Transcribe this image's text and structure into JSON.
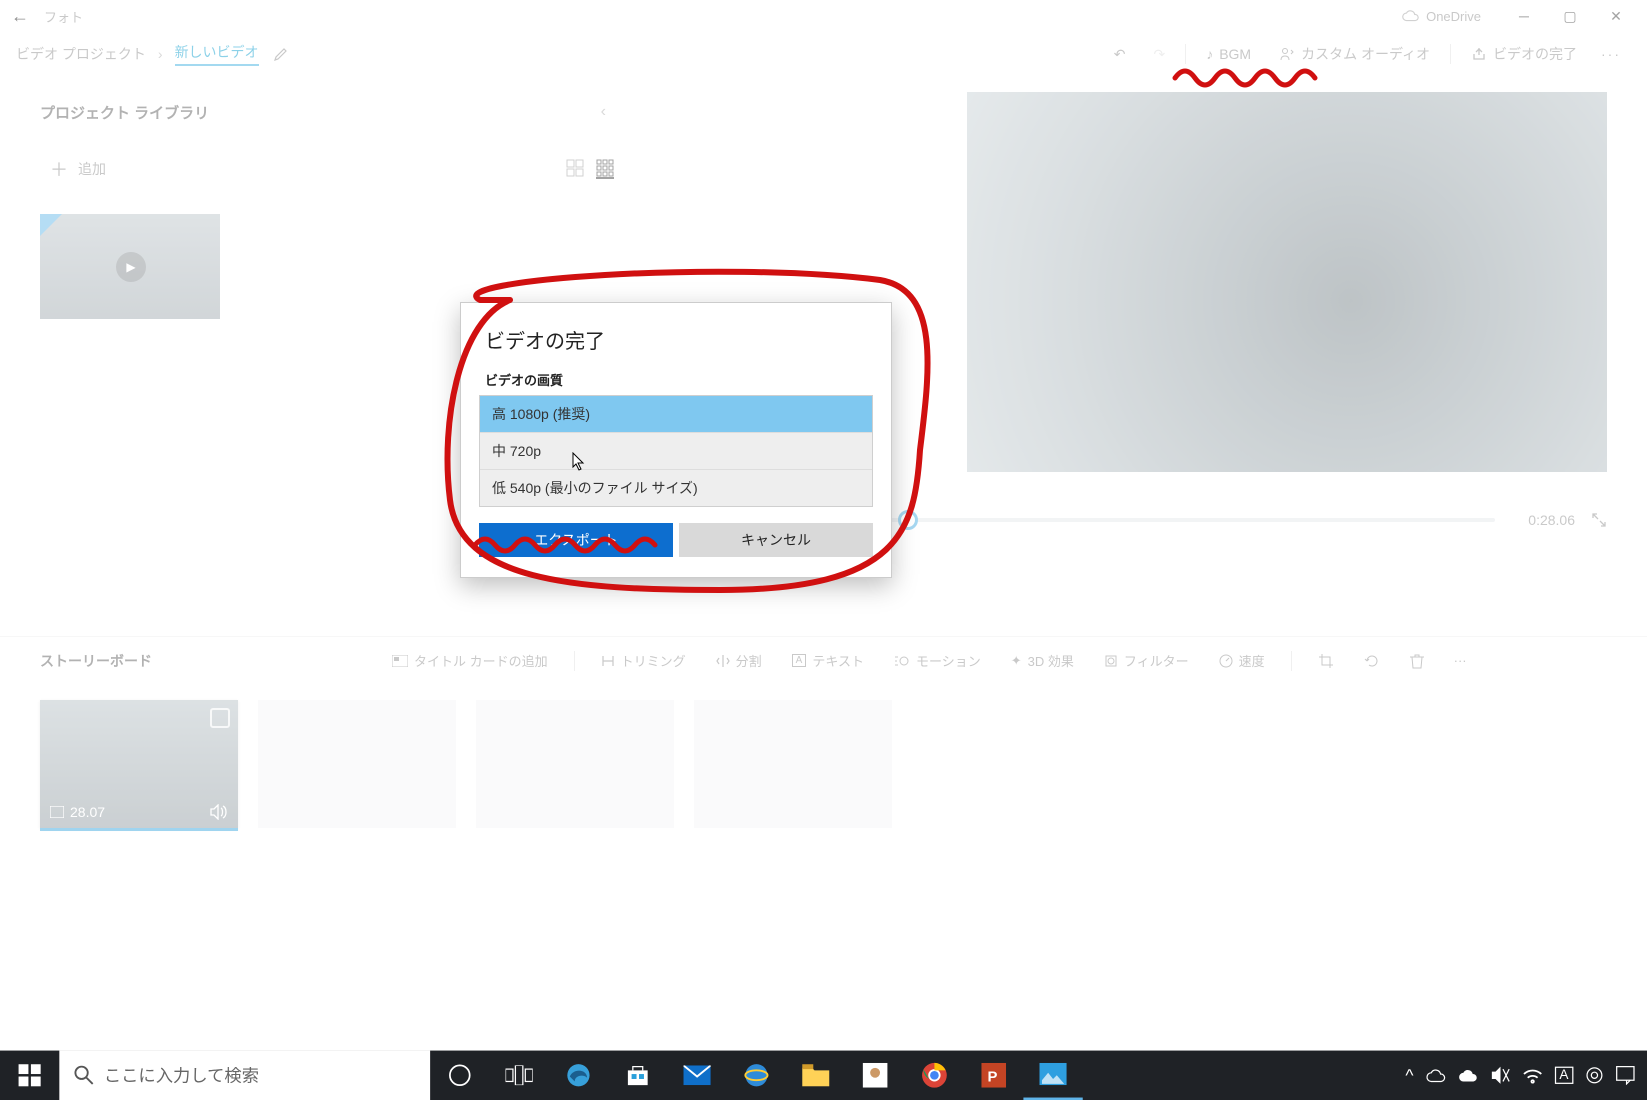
{
  "titlebar": {
    "app_name": "フォト",
    "onedrive": "OneDrive"
  },
  "breadcrumb": {
    "root": "ビデオ プロジェクト",
    "current": "新しいビデオ"
  },
  "toolbar": {
    "bgm": "BGM",
    "custom_audio": "カスタム オーディオ",
    "finish": "ビデオの完了"
  },
  "library": {
    "title": "プロジェクト ライブラリ",
    "add": "追加"
  },
  "timeline": {
    "duration": "0:28.06"
  },
  "storyboard": {
    "title": "ストーリーボード",
    "title_card": "タイトル カードの追加",
    "trim": "トリミング",
    "split": "分割",
    "text": "テキスト",
    "motion": "モーション",
    "effects3d": "3D 効果",
    "filter": "フィルター",
    "speed": "速度",
    "clip_duration": "28.07"
  },
  "dialog": {
    "title": "ビデオの完了",
    "sub": "ビデオの画質",
    "options": [
      "高 1080p (推奨)",
      "中 720p",
      "低 540p (最小のファイル サイズ)"
    ],
    "export": "エクスポート",
    "cancel": "キャンセル"
  },
  "taskbar": {
    "search_placeholder": "ここに入力して検索"
  }
}
